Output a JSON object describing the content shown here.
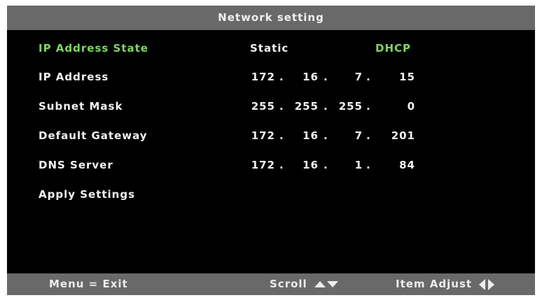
{
  "title": "Network setting",
  "colors": {
    "highlight": "#7ed957",
    "bar": "#696969",
    "background": "#000000",
    "text": "#f2f2f2"
  },
  "rows": {
    "ip_state": {
      "label": "IP Address State",
      "options": [
        "Static",
        "DHCP"
      ],
      "selected": "DHCP"
    },
    "ip_address": {
      "label": "IP Address",
      "octets": [
        "172",
        "16",
        "7",
        "15"
      ]
    },
    "subnet_mask": {
      "label": "Subnet Mask",
      "octets": [
        "255",
        "255",
        "255",
        "0"
      ]
    },
    "gateway": {
      "label": "Default Gateway",
      "octets": [
        "172",
        "16",
        "7",
        "201"
      ]
    },
    "dns": {
      "label": "DNS Server",
      "octets": [
        "172",
        "16",
        "1",
        "84"
      ]
    },
    "apply": {
      "label": "Apply Settings"
    }
  },
  "footer": {
    "exit": "Menu = Exit",
    "scroll": "Scroll",
    "scroll_icons": [
      "arrow-up-icon",
      "arrow-down-icon"
    ],
    "adjust": "Item Adjust",
    "adjust_icons": [
      "arrow-left-icon",
      "arrow-right-icon"
    ]
  }
}
